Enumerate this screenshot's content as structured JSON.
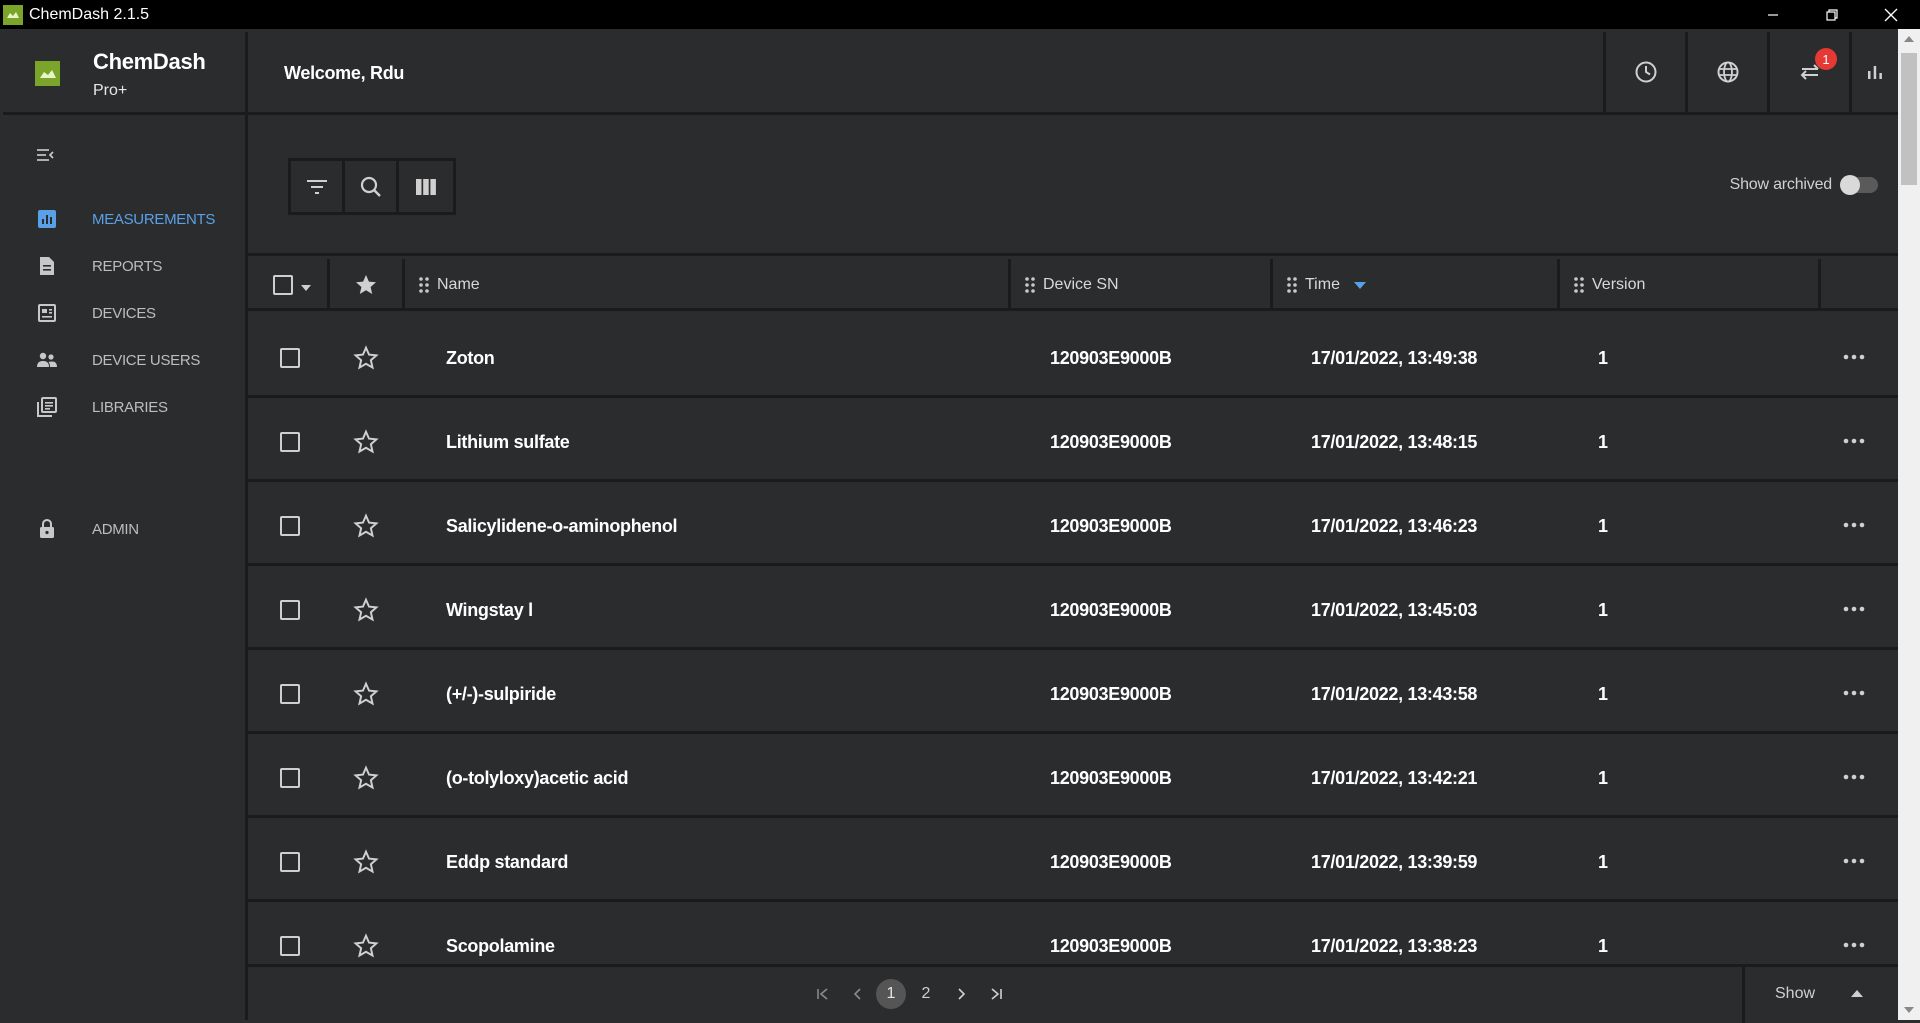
{
  "window": {
    "title": "ChemDash 2.1.5"
  },
  "brand": {
    "name": "ChemDash",
    "tier": "Pro+"
  },
  "header": {
    "welcome": "Welcome, Rdu",
    "notification_count": "1"
  },
  "sidebar": {
    "items": [
      {
        "label": "MEASUREMENTS",
        "icon": "bar-chart-icon",
        "active": true
      },
      {
        "label": "REPORTS",
        "icon": "document-icon"
      },
      {
        "label": "DEVICES",
        "icon": "device-icon"
      },
      {
        "label": "DEVICE USERS",
        "icon": "users-icon"
      },
      {
        "label": "LIBRARIES",
        "icon": "library-icon"
      },
      {
        "label": "ADMIN",
        "icon": "lock-icon"
      }
    ]
  },
  "toolbar": {
    "show_archived_label": "Show archived",
    "show_archived": false
  },
  "table": {
    "columns": [
      "Name",
      "Device SN",
      "Time",
      "Version"
    ],
    "sort_column": "Time",
    "rows": [
      {
        "name": "Zoton",
        "sn": "120903E9000B",
        "time": "17/01/2022, 13:49:38",
        "version": "1"
      },
      {
        "name": "Lithium sulfate",
        "sn": "120903E9000B",
        "time": "17/01/2022, 13:48:15",
        "version": "1"
      },
      {
        "name": "Salicylidene-o-aminophenol",
        "sn": "120903E9000B",
        "time": "17/01/2022, 13:46:23",
        "version": "1"
      },
      {
        "name": "Wingstay l",
        "sn": "120903E9000B",
        "time": "17/01/2022, 13:45:03",
        "version": "1"
      },
      {
        "name": "(+/-)-sulpiride",
        "sn": "120903E9000B",
        "time": "17/01/2022, 13:43:58",
        "version": "1"
      },
      {
        "name": "(o-tolyloxy)acetic acid",
        "sn": "120903E9000B",
        "time": "17/01/2022, 13:42:21",
        "version": "1"
      },
      {
        "name": "Eddp standard",
        "sn": "120903E9000B",
        "time": "17/01/2022, 13:39:59",
        "version": "1"
      },
      {
        "name": "Scopolamine",
        "sn": "120903E9000B",
        "time": "17/01/2022, 13:38:23",
        "version": "1"
      }
    ]
  },
  "pagination": {
    "pages": [
      "1",
      "2"
    ],
    "current": "1",
    "show_label": "Show"
  },
  "colors": {
    "accent": "#5aa0e6",
    "brand": "#7aa52a",
    "badge": "#e53935",
    "background": "#2b2c2e"
  }
}
